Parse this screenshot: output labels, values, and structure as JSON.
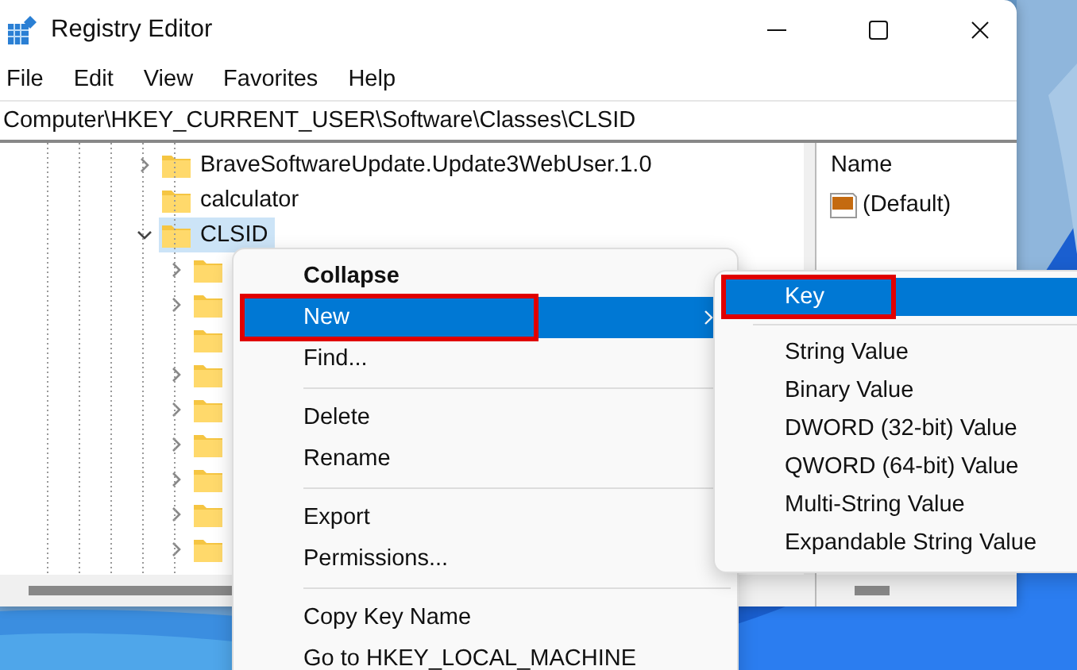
{
  "window": {
    "title": "Registry Editor"
  },
  "menu_bar": [
    "File",
    "Edit",
    "View",
    "Favorites",
    "Help"
  ],
  "address": "Computer\\HKEY_CURRENT_USER\\Software\\Classes\\CLSID",
  "tree": [
    {
      "label": "BraveSoftwareUpdate.Update3WebUser.1.0",
      "expandable": true,
      "selected": false
    },
    {
      "label": "calculator",
      "expandable": false,
      "selected": false
    },
    {
      "label": "CLSID",
      "expandable": true,
      "expanded": true,
      "selected": true,
      "children": [
        {
          "expandable": true
        },
        {
          "expandable": true
        },
        {
          "expandable": false
        },
        {
          "expandable": true
        },
        {
          "expandable": true
        },
        {
          "expandable": true
        },
        {
          "expandable": true
        },
        {
          "expandable": true
        },
        {
          "expandable": true
        }
      ]
    }
  ],
  "values_pane": {
    "column": "Name",
    "rows": [
      {
        "name": "(Default)"
      }
    ]
  },
  "context_menu": [
    {
      "kind": "item",
      "label": "Collapse",
      "bold": true,
      "selected": false,
      "submenu": false,
      "annotated": false
    },
    {
      "kind": "item",
      "label": "New",
      "bold": false,
      "selected": true,
      "submenu": true,
      "annotated": true
    },
    {
      "kind": "item",
      "label": "Find...",
      "bold": false,
      "selected": false,
      "submenu": false,
      "annotated": false
    },
    {
      "kind": "separator"
    },
    {
      "kind": "item",
      "label": "Delete",
      "bold": false,
      "selected": false,
      "submenu": false,
      "annotated": false
    },
    {
      "kind": "item",
      "label": "Rename",
      "bold": false,
      "selected": false,
      "submenu": false,
      "annotated": false
    },
    {
      "kind": "separator"
    },
    {
      "kind": "item",
      "label": "Export",
      "bold": false,
      "selected": false,
      "submenu": false,
      "annotated": false
    },
    {
      "kind": "item",
      "label": "Permissions...",
      "bold": false,
      "selected": false,
      "submenu": false,
      "annotated": false
    },
    {
      "kind": "separator"
    },
    {
      "kind": "item",
      "label": "Copy Key Name",
      "bold": false,
      "selected": false,
      "submenu": false,
      "annotated": false
    },
    {
      "kind": "item",
      "label": "Go to HKEY_LOCAL_MACHINE",
      "bold": false,
      "selected": false,
      "submenu": false,
      "annotated": false
    }
  ],
  "submenu": [
    {
      "kind": "item",
      "label": "Key",
      "selected": true,
      "annotated": true
    },
    {
      "kind": "separator"
    },
    {
      "kind": "item",
      "label": "String Value",
      "selected": false,
      "annotated": false
    },
    {
      "kind": "item",
      "label": "Binary Value",
      "selected": false,
      "annotated": false
    },
    {
      "kind": "item",
      "label": "DWORD (32-bit) Value",
      "selected": false,
      "annotated": false
    },
    {
      "kind": "item",
      "label": "QWORD (64-bit) Value",
      "selected": false,
      "annotated": false
    },
    {
      "kind": "item",
      "label": "Multi-String Value",
      "selected": false,
      "annotated": false
    },
    {
      "kind": "item",
      "label": "Expandable String Value",
      "selected": false,
      "annotated": false
    }
  ]
}
